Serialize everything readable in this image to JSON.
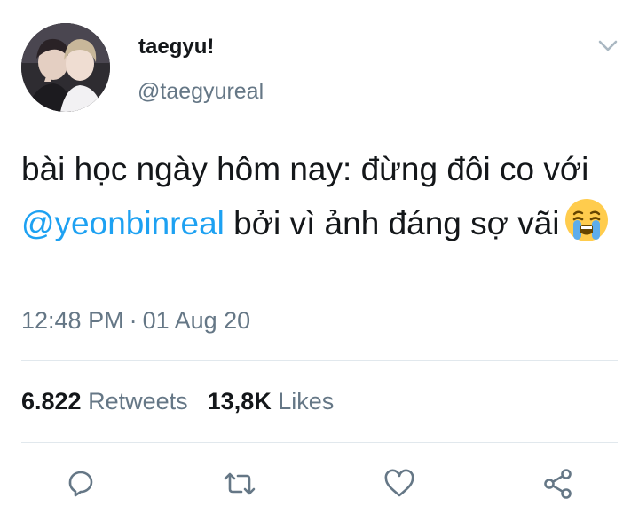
{
  "user": {
    "display_name": "taegyu!",
    "handle": "@taegyureal"
  },
  "tweet": {
    "text_part1": "bài học ngày hôm nay: đừng đôi co với ",
    "mention": "@yeonbinreal",
    "text_part2": " bởi vì ảnh đáng sợ vãi",
    "emoji": "loudly-crying-face",
    "time": "12:48 PM",
    "separator": "·",
    "date": "01 Aug 20"
  },
  "stats": {
    "retweets_count": "6.822",
    "retweets_label": "Retweets",
    "likes_count": "13,8K",
    "likes_label": "Likes"
  },
  "actions": [
    "reply-icon",
    "retweet-icon",
    "like-icon",
    "share-icon"
  ],
  "colors": {
    "accent": "#1da1f2",
    "secondary_text": "#657786",
    "primary_text": "#14171a",
    "divider": "#e1e8ed"
  }
}
